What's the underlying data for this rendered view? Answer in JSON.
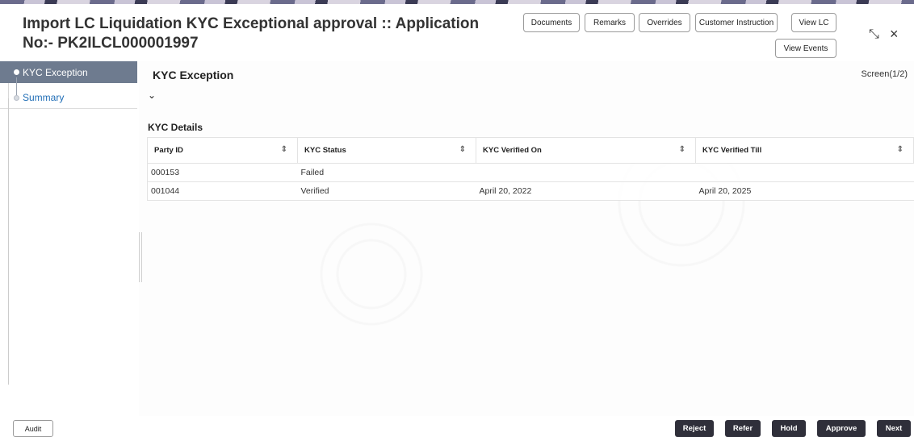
{
  "header": {
    "title": "Import LC Liquidation KYC Exceptional approval :: Application No:- PK2ILCL000001997",
    "buttons": {
      "documents": "Documents",
      "remarks": "Remarks",
      "overrides": "Overrides",
      "customer_instruction": "Customer Instruction",
      "view_lc": "View LC",
      "view_events": "View Events"
    },
    "controls": {
      "minimize": "⤡",
      "close": "×"
    }
  },
  "sidebar": {
    "items": [
      {
        "label": "KYC Exception",
        "active": true
      },
      {
        "label": "Summary",
        "active": false
      }
    ]
  },
  "main": {
    "section_title": "KYC Exception",
    "screen_indicator": "Screen(1/2)",
    "subsection_title": "KYC Details",
    "table": {
      "columns": [
        "Party ID",
        "KYC Status",
        "KYC Verified On",
        "KYC Verified Till"
      ],
      "rows": [
        [
          "000153",
          "Failed",
          "",
          ""
        ],
        [
          "001044",
          "Verified",
          "April 20, 2022",
          "April 20, 2025"
        ]
      ]
    }
  },
  "footer": {
    "audit": "Audit",
    "reject": "Reject",
    "refer": "Refer",
    "hold": "Hold",
    "approve": "Approve",
    "next": "Next"
  },
  "colors": {
    "sidebar_active": "#6e7b8f",
    "link": "#1f6db6",
    "footer_button": "#2f2f3a"
  }
}
